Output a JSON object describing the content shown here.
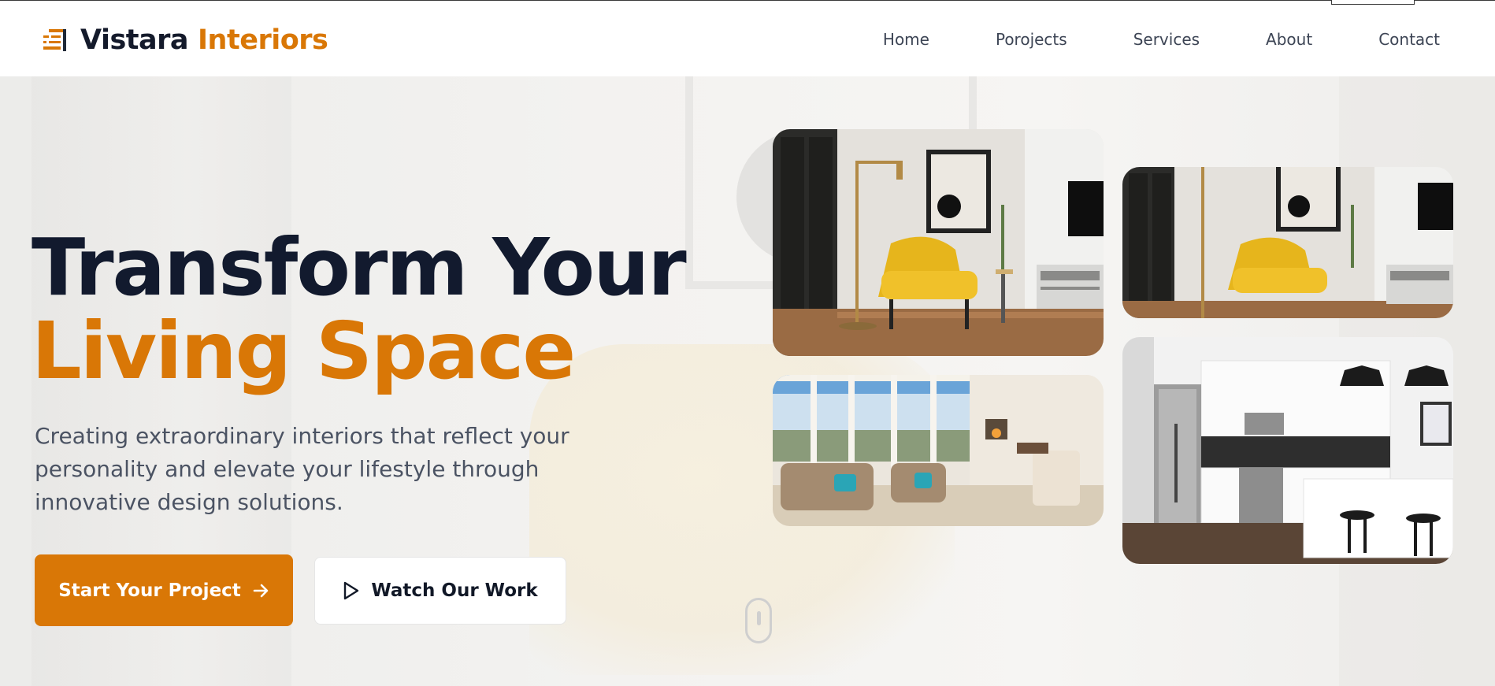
{
  "brand": {
    "name_part1": "Vistara",
    "name_part2": "Interiors",
    "icon": "logo-lines-icon"
  },
  "nav": {
    "items": [
      "Home",
      "Porojects",
      "Services",
      "About",
      "Contact"
    ]
  },
  "hero": {
    "title_line1": "Transform Your",
    "title_line2": "Living Space",
    "subtitle": "Creating extraordinary interiors that reflect your personality and elevate your lifestyle through innovative design solutions.",
    "primary_button": "Start Your Project",
    "primary_button_icon": "arrow-right-icon",
    "secondary_button": "Watch Our Work",
    "secondary_button_icon": "play-icon"
  },
  "gallery": [
    {
      "name": "living-room-yellow-chair"
    },
    {
      "name": "living-room-yellow-chair-crop"
    },
    {
      "name": "sunny-living-room-with-view"
    },
    {
      "name": "modern-white-kitchen"
    }
  ],
  "colors": {
    "accent": "#d97706",
    "dark": "#121a2e",
    "text_muted": "#4b5363",
    "header_bg": "#ffffff"
  }
}
